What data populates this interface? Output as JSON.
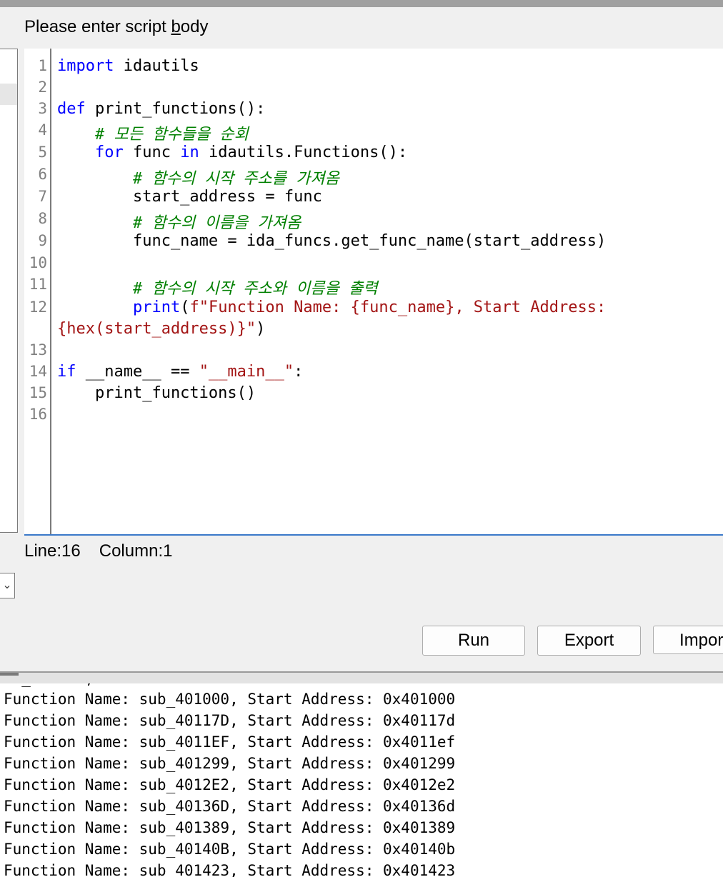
{
  "dialog": {
    "prompt_pre": "Please enter script ",
    "prompt_hot": "b",
    "prompt_post": "ody"
  },
  "editor": {
    "line_numbers": [
      "1",
      "2",
      "3",
      "4",
      "5",
      "6",
      "7",
      "8",
      "9",
      "10",
      "11",
      "12",
      "13",
      "14",
      "15",
      "16"
    ],
    "code": {
      "l1_kw": "import",
      "l1_rest": " idautils",
      "l3_kw": "def",
      "l3_rest": " print_functions():",
      "l4_indent": "    ",
      "l4_cm": "# 모든 함수들을 순회",
      "l5_indent": "    ",
      "l5_kw1": "for",
      "l5_mid": " func ",
      "l5_kw2": "in",
      "l5_rest": " idautils.Functions():",
      "l6_indent": "        ",
      "l6_cm": "# 함수의 시작 주소를 가져옴",
      "l7": "        start_address = func",
      "l8_indent": "        ",
      "l8_cm": "# 함수의 이름을 가져옴",
      "l9": "        func_name = ida_funcs.get_func_name(start_address)",
      "l11_indent": "        ",
      "l11_cm": "# 함수의 시작 주소와 이름을 출력",
      "l12_indent": "        ",
      "l12_kw": "print",
      "l12_paren": "(",
      "l12_str": "f\"Function Name: {func_name}, Start Address:",
      "l12b_str": "{hex(start_address)}\"",
      "l12b_paren": ")",
      "l14_kw": "if",
      "l14_mid": " __name__ == ",
      "l14_str": "\"__main__\"",
      "l14_end": ":",
      "l15": "    print_functions()"
    }
  },
  "status": {
    "line": "Line:16",
    "column": "Column:1"
  },
  "buttons": {
    "run": "Run",
    "export": "Export",
    "import": "Import"
  },
  "output": {
    "lines": [
      "Function Name: sub_401000, Start Address: 0x401000",
      "Function Name: sub_40117D, Start Address: 0x40117d",
      "Function Name: sub_4011EF, Start Address: 0x4011ef",
      "Function Name: sub_401299, Start Address: 0x401299",
      "Function Name: sub_4012E2, Start Address: 0x4012e2",
      "Function Name: sub_40136D, Start Address: 0x40136d",
      "Function Name: sub_401389, Start Address: 0x401389",
      "Function Name: sub_40140B, Start Address: 0x40140b",
      "Function Name: sub_401423, Start Address: 0x401423"
    ]
  },
  "colors": {
    "keyword": "#0000ff",
    "comment": "#008000",
    "string": "#a31515",
    "caret_border": "#3b79c9"
  }
}
